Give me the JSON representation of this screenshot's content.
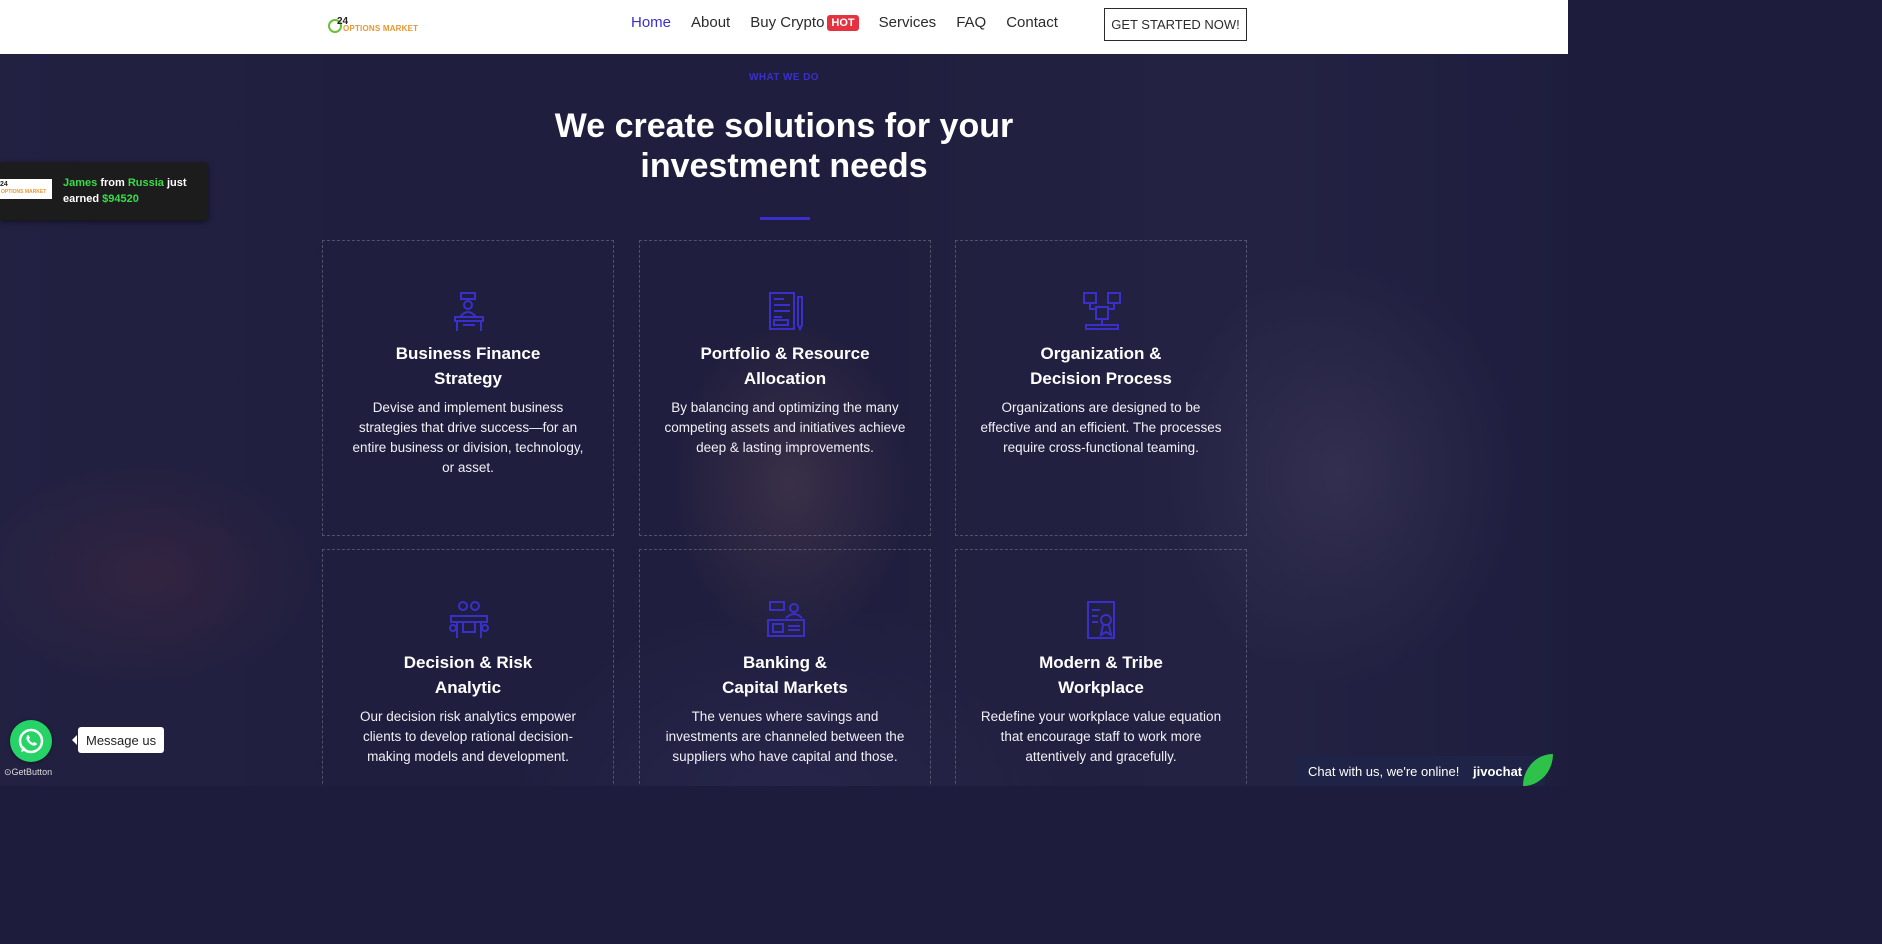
{
  "nav": {
    "logo_num": "24",
    "logo_text": "OPTIONS MARKET",
    "items": [
      {
        "label": "Home"
      },
      {
        "label": "About"
      },
      {
        "label": "Buy Crypto",
        "badge": "HOT"
      },
      {
        "label": "Services"
      },
      {
        "label": "FAQ"
      },
      {
        "label": "Contact"
      }
    ],
    "cta": "GET STARTED NOW!"
  },
  "section": {
    "eyebrow": "WHAT WE DO",
    "title_line1": "We create solutions for your",
    "title_line2": "investment needs"
  },
  "cards": [
    {
      "title1": "Business Finance",
      "title2": "Strategy",
      "text": "Devise and implement business strategies that drive success—for an entire business or division, technology, or asset.",
      "icon": "desk-worker-icon"
    },
    {
      "title1": "Portfolio & Resource",
      "title2": "Allocation",
      "text": "By balancing and optimizing the many competing assets and initiatives achieve deep & lasting improvements.",
      "icon": "document-pen-icon"
    },
    {
      "title1": "Organization &",
      "title2": "Decision Process",
      "text": "Organizations are designed to be effective and an efficient. The processes require cross-functional teaming.",
      "icon": "org-chart-icon"
    },
    {
      "title1": "Decision & Risk",
      "title2": "Analytic",
      "text": "Our decision risk analytics empower clients to develop rational decision-making models and development.",
      "icon": "meeting-table-icon"
    },
    {
      "title1": "Banking &",
      "title2": "Capital Markets",
      "text": "The venues where savings and investments are channeled between the suppliers who have capital and those.",
      "icon": "banking-icon"
    },
    {
      "title1": "Modern & Tribe",
      "title2": "Workplace",
      "text": "Redefine your workplace value equation that encourage staff to work more attentively and gracefully.",
      "icon": "certificate-icon"
    }
  ],
  "notification": {
    "name": "James",
    "from": "from",
    "country": "Russia",
    "just": "just",
    "earned": "earned",
    "amount": "$94520"
  },
  "whatsapp": {
    "message": "Message us",
    "brand": "GetButton"
  },
  "chat": {
    "text": "Chat with us, we're online!",
    "brand": "jivochat"
  },
  "colors": {
    "accent": "#3a30c9",
    "hot": "#e53240",
    "earn_green": "#3adc4a",
    "whatsapp": "#25d366"
  }
}
